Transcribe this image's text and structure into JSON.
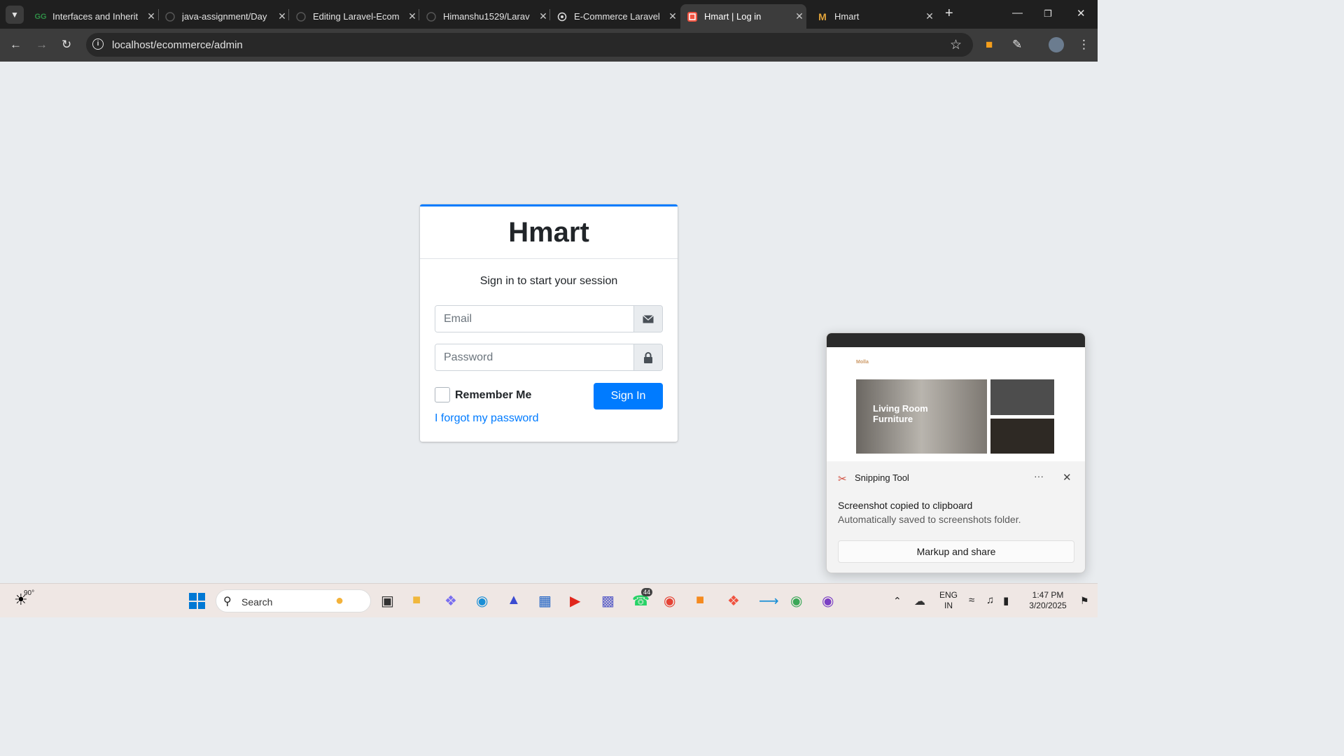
{
  "browser": {
    "tabs": [
      {
        "title": "Interfaces and Inherit",
        "icon": "gfg-icon"
      },
      {
        "title": "java-assignment/Day",
        "icon": "github-icon"
      },
      {
        "title": "Editing Laravel-Ecom",
        "icon": "github-icon"
      },
      {
        "title": "Himanshu1529/Larav",
        "icon": "github-icon"
      },
      {
        "title": "E-Commerce Laravel",
        "icon": "chatgpt-icon"
      },
      {
        "title": "Hmart | Log in",
        "icon": "laravel-icon",
        "active": true
      },
      {
        "title": "Hmart",
        "icon": "gmail-icon"
      }
    ],
    "url": "localhost/ecommerce/admin"
  },
  "login": {
    "brand": "Hmart",
    "message": "Sign in to start your session",
    "email_placeholder": "Email",
    "password_placeholder": "Password",
    "remember_label": "Remember Me",
    "signin_label": "Sign In",
    "forgot_label": "I forgot my password"
  },
  "toast": {
    "app": "Snipping Tool",
    "title": "Screenshot copied to clipboard",
    "subtitle": "Automatically saved to screenshots folder.",
    "button": "Markup and share",
    "preview_logo": "Molla",
    "preview_heading": "Living Room Furniture"
  },
  "taskbar": {
    "temperature": "90°",
    "search_label": "Search",
    "whatsapp_badge": "44",
    "lang": "ENG",
    "region": "IN",
    "time": "1:47 PM",
    "date": "3/20/2025"
  }
}
